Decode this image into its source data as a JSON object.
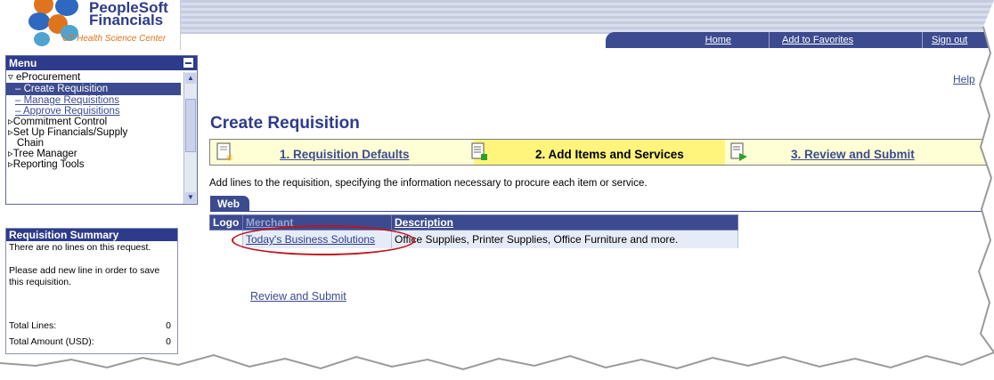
{
  "header": {
    "brand_line1": "PeopleSoft",
    "brand_line2": "Financials",
    "org": "UT Health Science Center",
    "nav": [
      "Home",
      "Add to Favorites",
      "Sign out"
    ]
  },
  "menu": {
    "title": "Menu",
    "items": [
      {
        "label": "eProcurement",
        "type": "folder-open"
      },
      {
        "label": "– Create Requisition",
        "type": "selected"
      },
      {
        "label": "– Manage Requisitions",
        "type": "link"
      },
      {
        "label": "– Approve Requisitions",
        "type": "link"
      },
      {
        "label": "Commitment Control",
        "type": "folder"
      },
      {
        "label": "Set Up Financials/Supply",
        "type": "folder"
      },
      {
        "label": "Chain",
        "type": "cont"
      },
      {
        "label": "Tree Manager",
        "type": "folder"
      },
      {
        "label": "Reporting Tools",
        "type": "folder"
      }
    ]
  },
  "summary": {
    "title": "Requisition Summary",
    "no_lines": "There are no lines on this request.",
    "hint": "Please add new line in order to save this requisition.",
    "total_lines_label": "Total Lines:",
    "total_lines_value": "0",
    "total_amount_label": "Total Amount (USD):",
    "total_amount_value": "0"
  },
  "main": {
    "help": "Help",
    "title": "Create Requisition",
    "steps": [
      {
        "label": "1. Requisition Defaults",
        "active": false
      },
      {
        "label": "2. Add Items and Services",
        "active": true
      },
      {
        "label": "3. Review and Submit",
        "active": false
      }
    ],
    "intro": "Add lines to the requisition, specifying the information necessary to procure each item or service.",
    "tab": "Web",
    "columns": [
      "Logo",
      "Merchant",
      "Description"
    ],
    "rows": [
      {
        "logo": "",
        "merchant": "Today's Business Solutions",
        "description": "Office Supplies, Printer Supplies, Office Furniture and more."
      }
    ],
    "review_link": "Review and Submit"
  },
  "colors": {
    "brand_blue": "#2e3b8c",
    "nav_blue": "#3c4b8f",
    "step_bg": "#ffffd5",
    "step_active": "#fff47c",
    "highlight_circle": "#c0141c",
    "logo_orange": "#e0741e"
  }
}
